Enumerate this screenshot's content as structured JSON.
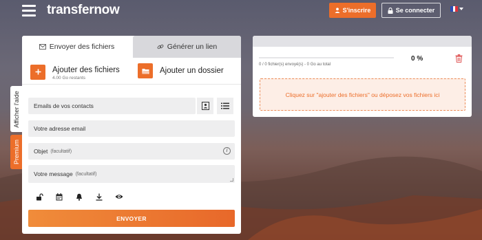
{
  "header": {
    "logo": "transfernow",
    "signup_label": "S'inscrire",
    "login_label": "Se connecter",
    "language_flag": "fr-flag-icon"
  },
  "side_tabs": {
    "help_label": "Afficher l'aide",
    "premium_label": "Premium"
  },
  "tabs": {
    "send_label": "Envoyer des fichiers",
    "link_label": "Générer un lien"
  },
  "upload": {
    "add_files_label": "Ajouter des fichiers",
    "remaining_label": "4.00 Go restants",
    "add_folder_label": "Ajouter un dossier"
  },
  "form": {
    "contacts_label": "Emails de vos contacts",
    "email_label": "Votre adresse email",
    "subject_label": "Objet",
    "subject_optional": "(facultatif)",
    "message_label": "Votre message",
    "message_optional": "(facultatif)",
    "send_button": "ENVOYER",
    "option_icons": [
      "unlock-icon",
      "calendar-icon",
      "bell-icon",
      "download-icon",
      "eye-icon"
    ]
  },
  "transfer": {
    "progress_text": "0 / 0 fichier(s) envoyé(s) - 0 Go au total",
    "percent_label": "0 %",
    "progress_value": 0,
    "drop_text": "Cliquez sur \"ajouter des fichiers\" ou déposez vos fichiers ici"
  },
  "colors": {
    "accent": "#ec6e2a",
    "tab_inactive": "#d8d8dc",
    "field_bg": "#eeeeef",
    "drop_bg": "#fdeee6",
    "trash": "#e05a5a"
  }
}
